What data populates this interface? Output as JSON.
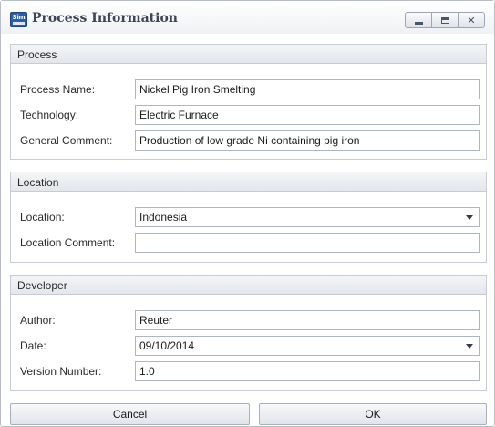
{
  "window": {
    "title": "Process Information",
    "icon_label": "Sim"
  },
  "groups": {
    "process": {
      "header": "Process",
      "name_label": "Process Name:",
      "name_value": "Nickel Pig Iron Smelting",
      "technology_label": "Technology:",
      "technology_value": "Electric Furnace",
      "comment_label": "General Comment:",
      "comment_value": "Production of low grade Ni containing pig iron"
    },
    "location": {
      "header": "Location",
      "location_label": "Location:",
      "location_value": "Indonesia",
      "comment_label": "Location Comment:",
      "comment_value": ""
    },
    "developer": {
      "header": "Developer",
      "author_label": "Author:",
      "author_value": "Reuter",
      "date_label": "Date:",
      "date_value": "09/10/2014",
      "version_label": "Version Number:",
      "version_value": "1.0"
    }
  },
  "buttons": {
    "cancel": "Cancel",
    "ok": "OK"
  },
  "window_buttons": {
    "maximize_glyph": "□",
    "close_glyph": "✕"
  },
  "icons": {
    "app": "sim-app-icon",
    "minimize": "minimize-icon",
    "maximize": "maximize-icon",
    "close": "close-icon",
    "dropdown": "chevron-down-icon"
  }
}
